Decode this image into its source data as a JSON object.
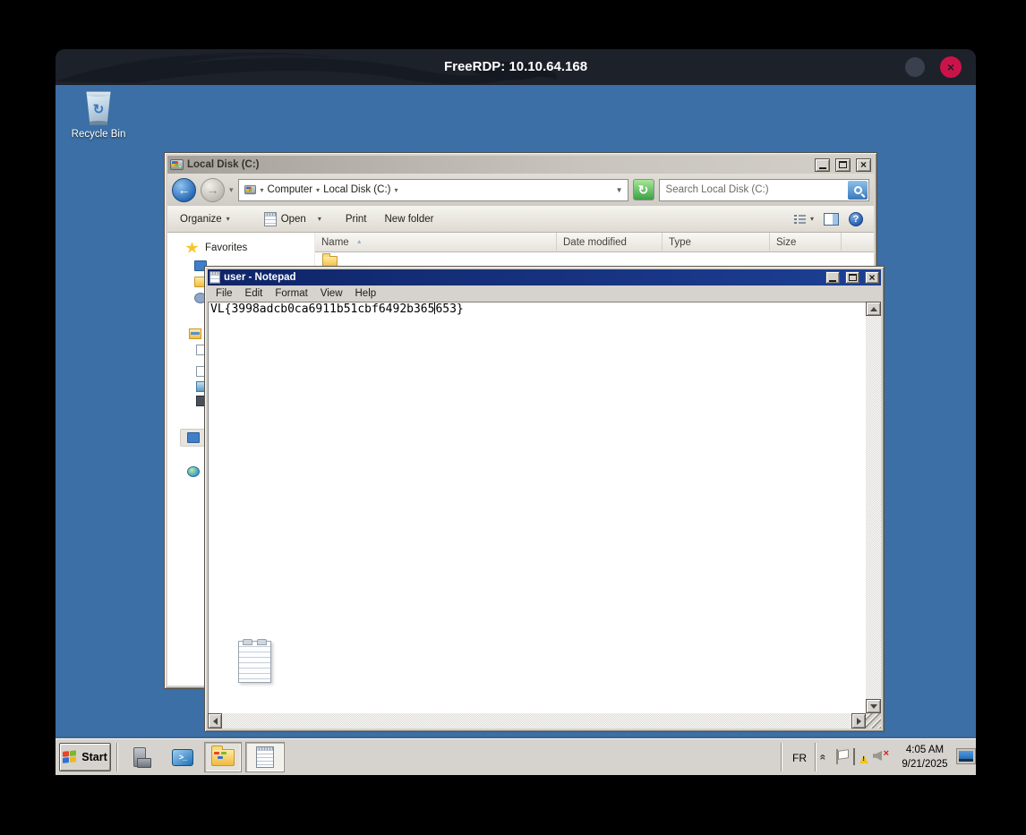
{
  "frame": {
    "title": "FreeRDP: 10.10.64.168"
  },
  "desktop": {
    "recycle_bin_label": "Recycle Bin"
  },
  "explorer": {
    "title": "Local Disk (C:)",
    "nav": {
      "crumb_computer": "Computer",
      "crumb_disk": "Local Disk (C:)"
    },
    "search_placeholder": "Search Local Disk (C:)",
    "toolbar": {
      "organize": "Organize",
      "open": "Open",
      "print": "Print",
      "new_folder": "New folder"
    },
    "columns": {
      "name": "Name",
      "date": "Date modified",
      "type": "Type",
      "size": "Size"
    },
    "sidebar": {
      "favorites": "Favorites"
    }
  },
  "notepad": {
    "title": "user - Notepad",
    "menus": [
      "File",
      "Edit",
      "Format",
      "View",
      "Help"
    ],
    "text_before_caret": "VL{3998adcb0ca6911b51cbf6492b365",
    "text_after_caret": "653}",
    "full_text": "VL{3998adcb0ca6911b51cbf6492b365653}"
  },
  "taskbar": {
    "start": "Start",
    "language": "FR",
    "time": "4:05 AM",
    "date": "9/21/2025"
  },
  "icons": {
    "back": "←",
    "forward": "→",
    "dropdown": "▼",
    "dropdown_small": "▾",
    "sort_asc": "▲",
    "refresh": "↻",
    "help": "?",
    "close": "×",
    "chevron_up": "«",
    "recycle": "↻",
    "powershell": ">_"
  },
  "colors": {
    "desktop": "#3b6fa5",
    "chrome_dark": "#1d212a",
    "close_red": "#cb134a",
    "classic_gray": "#d6d3ce",
    "notepad_title_left": "#0f2468",
    "notepad_title_right": "#1d3f94"
  }
}
